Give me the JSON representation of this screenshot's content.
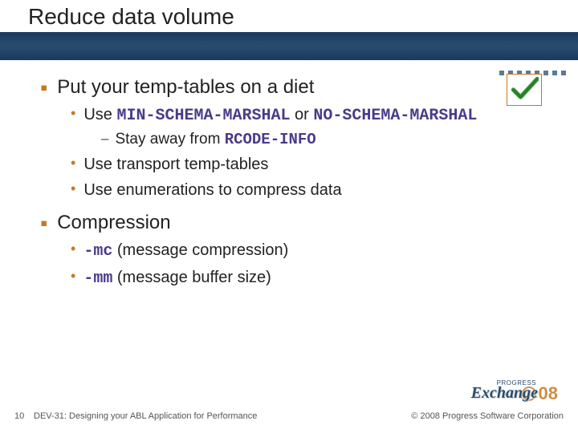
{
  "title": "Reduce data volume",
  "bullets": {
    "b1": {
      "text": "Put your temp-tables on a diet",
      "sub": [
        {
          "prefix": "Use ",
          "code1": "MIN-SCHEMA-MARSHAL",
          "mid": " or ",
          "code2": "NO-SCHEMA-MARSHAL",
          "sub": {
            "prefix": "Stay away from ",
            "code": "RCODE-INFO"
          }
        },
        {
          "text": "Use transport temp-tables"
        },
        {
          "text": "Use enumerations to compress data"
        }
      ]
    },
    "b2": {
      "text": "Compression",
      "sub": [
        {
          "code": "-mc",
          "suffix": " (message compression)"
        },
        {
          "code": "-mm",
          "suffix": " (message buffer size)"
        }
      ]
    }
  },
  "footer": {
    "page": "10",
    "title": "DEV-31: Designing your ABL Application for Performance",
    "copyright": "© 2008 Progress Software Corporation",
    "logo_progress": "PROGRESS",
    "logo_exchange": "Exchange",
    "logo_year": "08"
  }
}
